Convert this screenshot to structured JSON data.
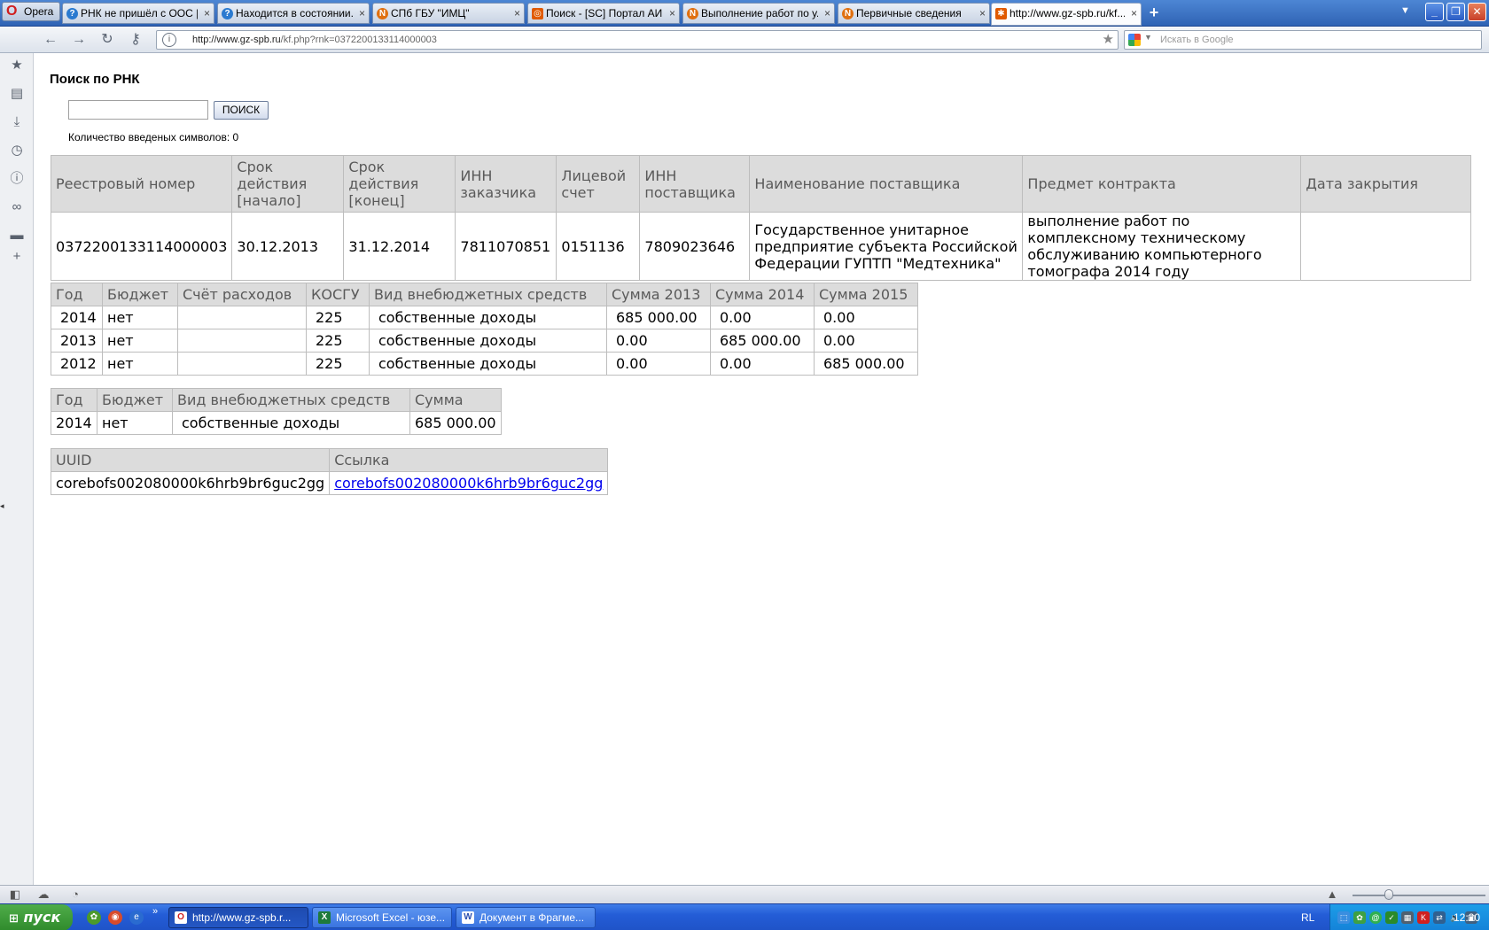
{
  "browser": {
    "menu_label": "Opera",
    "tabs": [
      {
        "label": "РНК не пришёл с ООС | ...",
        "favicon": "q",
        "close": "×"
      },
      {
        "label": "Находится в состоянии...",
        "favicon": "q",
        "close": "×"
      },
      {
        "label": "СПб ГБУ \"ИМЦ\"",
        "favicon": "n",
        "close": "×"
      },
      {
        "label": "Поиск - [SC] Портал АИ...",
        "favicon": "p",
        "close": "×"
      },
      {
        "label": "Выполнение работ по у...",
        "favicon": "n",
        "close": "×"
      },
      {
        "label": "Первичные сведения",
        "favicon": "n",
        "close": "×"
      },
      {
        "label": "http://www.gz-spb.ru/kf...",
        "favicon": "p",
        "close": "×",
        "active": true
      }
    ],
    "new_tab": "+",
    "address": {
      "domain": "http://www.gz-spb.ru",
      "path": "/kf.php?rnk=0372200133114000003"
    },
    "search_placeholder": "Искать в Google"
  },
  "page": {
    "title": "Поиск по РНК",
    "search_input_value": "",
    "search_button": "ПОИСК",
    "char_count_text": "Количество введеных символов: 0",
    "contract_table": {
      "headers": [
        "Реестровый номер",
        "Срок действия [начало]",
        "Срок действия [конец]",
        "ИНН заказчика",
        "Лицевой счет",
        "ИНН поставщика",
        "Наименование поставщика",
        "Предмет контракта",
        "Дата закрытия"
      ],
      "row": [
        "0372200133114000003",
        "30.12.2013",
        "31.12.2014",
        "7811070851",
        "0151136",
        "7809023646",
        "Государственное унитарное предприятие субъекта Российской Федерации ГУПТП \"Медтехника\"",
        "выполнение работ по комплексному техническому обслуживанию компьютерного томографа 2014 году",
        ""
      ]
    },
    "finance_table": {
      "headers": [
        "Год",
        "Бюджет",
        "Счёт расходов",
        "КОСГУ",
        "Вид внебюджетных средств",
        "Сумма 2013",
        "Сумма 2014",
        "Сумма 2015"
      ],
      "rows": [
        [
          "2014",
          "нет",
          "",
          "225",
          "собственные доходы",
          "685 000.00",
          "0.00",
          "0.00"
        ],
        [
          "2013",
          "нет",
          "",
          "225",
          "собственные доходы",
          "0.00",
          "685 000.00",
          "0.00"
        ],
        [
          "2012",
          "нет",
          "",
          "225",
          "собственные доходы",
          "0.00",
          "0.00",
          "685 000.00"
        ]
      ]
    },
    "sum_table": {
      "headers": [
        "Год",
        "Бюджет",
        "Вид внебюджетных средств",
        "Сумма"
      ],
      "rows": [
        [
          "2014",
          "нет",
          "собственные доходы",
          "685 000.00"
        ]
      ]
    },
    "uuid_table": {
      "headers": [
        "UUID",
        "Ссылка"
      ],
      "rows": [
        [
          "corebofs002080000k6hrb9br6guc2gg",
          "corebofs002080000k6hrb9br6guc2gg"
        ]
      ]
    }
  },
  "taskbar": {
    "start_label": "пуск",
    "windows": [
      {
        "label": "http://www.gz-spb.r...",
        "icon": "O",
        "active": true
      },
      {
        "label": "Microsoft Excel - юзе...",
        "icon": "X"
      },
      {
        "label": "Документ в Фрагме...",
        "icon": "W"
      }
    ],
    "lang": "RL",
    "clock": "12:20"
  }
}
